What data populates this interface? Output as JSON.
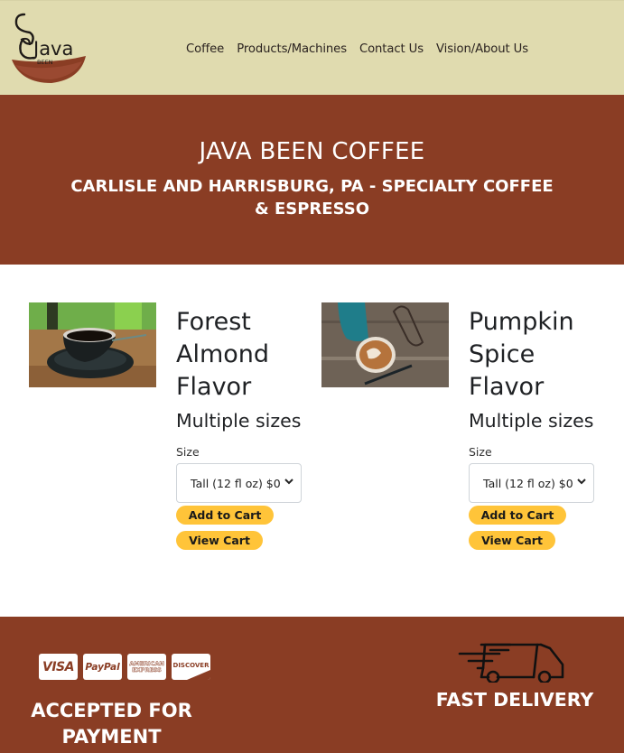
{
  "header": {
    "logo": {
      "text": "Java",
      "subtext": "BEEN",
      "icon": "coffee-cup-logo-icon"
    },
    "nav": [
      {
        "label": "Coffee"
      },
      {
        "label": "Products/Machines"
      },
      {
        "label": "Contact Us"
      },
      {
        "label": "Vision/About Us"
      }
    ]
  },
  "hero": {
    "title": "JAVA BEEN COFFEE",
    "subtitle": "CARLISLE AND HARRISBURG, PA - SPECIALTY COFFEE & ESPRESSO"
  },
  "products": [
    {
      "image_alt": "Black coffee cup on saucer",
      "title": "Forest Almond Flavor",
      "subtitle": "Multiple sizes",
      "size_label": "Size",
      "size_selected": "Tall (12 fl oz) $0",
      "add_to_cart": "Add to Cart",
      "view_cart": "View Cart"
    },
    {
      "image_alt": "Latte with glasses and pen on wooden table",
      "title": "Pumpkin Spice Flavor",
      "subtitle": "Multiple sizes",
      "size_label": "Size",
      "size_selected": "Tall (12 fl oz) $0",
      "add_to_cart": "Add to Cart",
      "view_cart": "View Cart"
    }
  ],
  "footer": {
    "cards": [
      {
        "name": "VISA"
      },
      {
        "name": "PayPal"
      },
      {
        "name": "AMERICAN EXPRESS"
      },
      {
        "name": "DISCOVER"
      }
    ],
    "payment_caption": "ACCEPTED FOR PAYMENT",
    "delivery_caption": "FAST DELIVERY"
  },
  "colors": {
    "header_bg": "#e0dbaf",
    "brand_brown": "#8a3d24",
    "paypal_yellow": "#ffc439"
  }
}
